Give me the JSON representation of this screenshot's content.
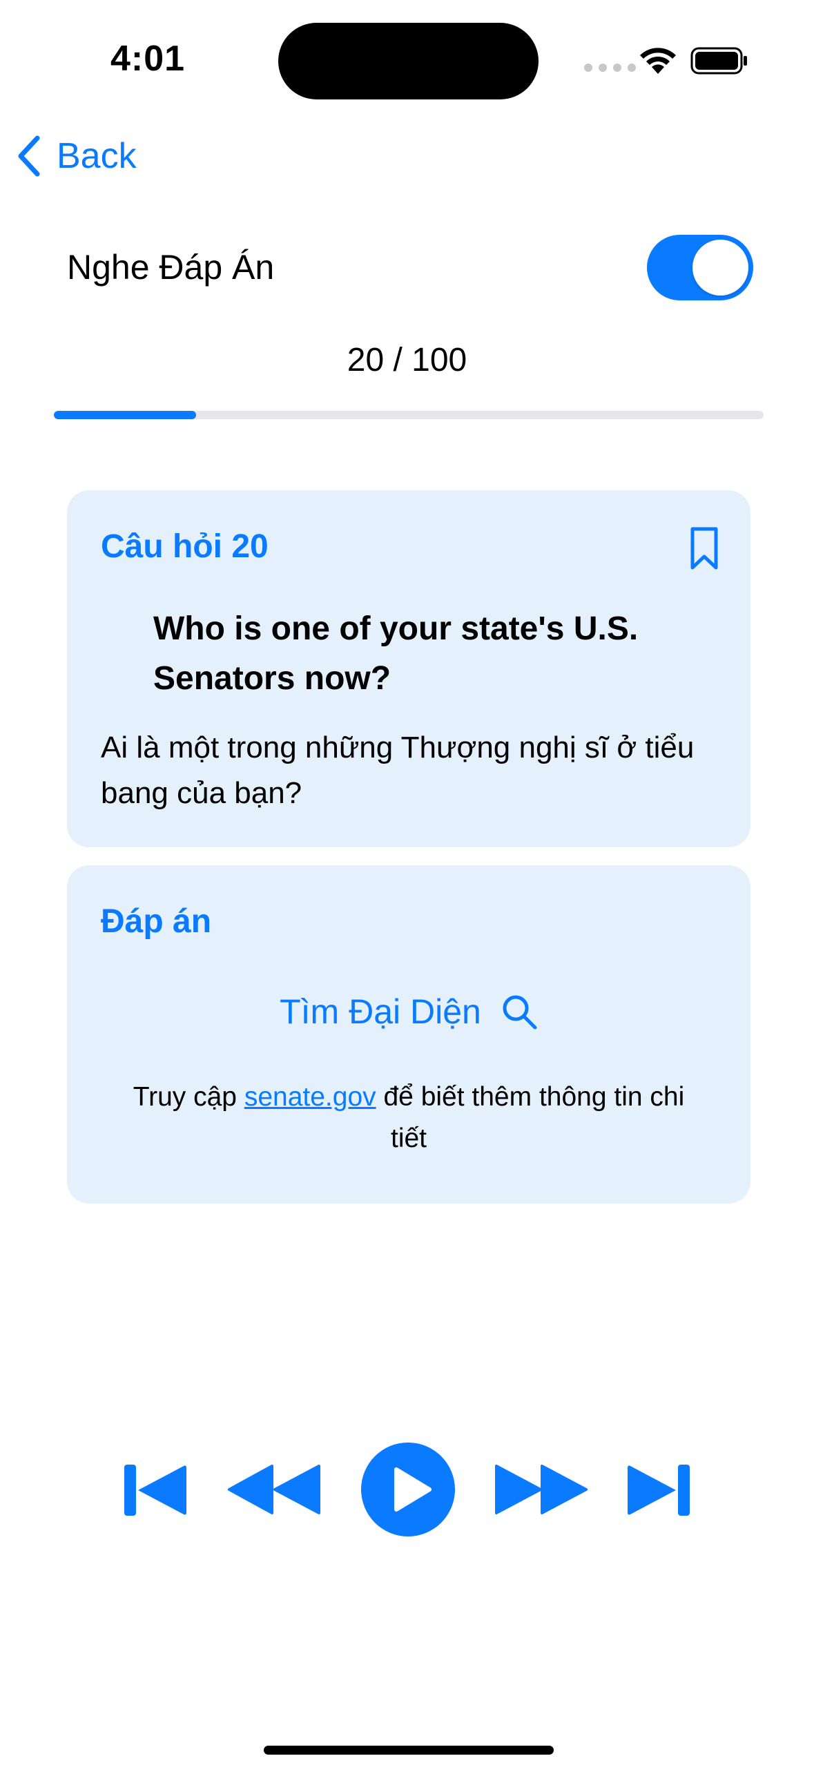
{
  "status_bar": {
    "time": "4:01"
  },
  "nav": {
    "back_label": "Back"
  },
  "settings": {
    "listen_answer_label": "Nghe Đáp Án",
    "listen_answer_on": true
  },
  "progress": {
    "text": "20 / 100",
    "current": 20,
    "total": 100,
    "fraction": 0.2
  },
  "question_card": {
    "title": "Câu hỏi 20",
    "question_en": "Who is one of your state's U.S. Senators now?",
    "question_vi": "Ai là một trong những Thượng nghị sĩ ở tiểu bang của bạn?",
    "bookmark_icon": "bookmark-icon"
  },
  "answer_card": {
    "title": "Đáp án",
    "find_rep_label": "Tìm Đại Diện",
    "note_prefix": "Truy cập ",
    "note_link": "senate.gov",
    "note_suffix": " để biết thêm thông tin chi tiết"
  },
  "player": {
    "icons": [
      "skip-to-start-icon",
      "rewind-icon",
      "play-icon",
      "fast-forward-icon",
      "skip-to-end-icon"
    ]
  },
  "colors": {
    "accent": "#0a7aff",
    "card_bg": "#e4f0fc",
    "track": "#e5e5ea"
  }
}
